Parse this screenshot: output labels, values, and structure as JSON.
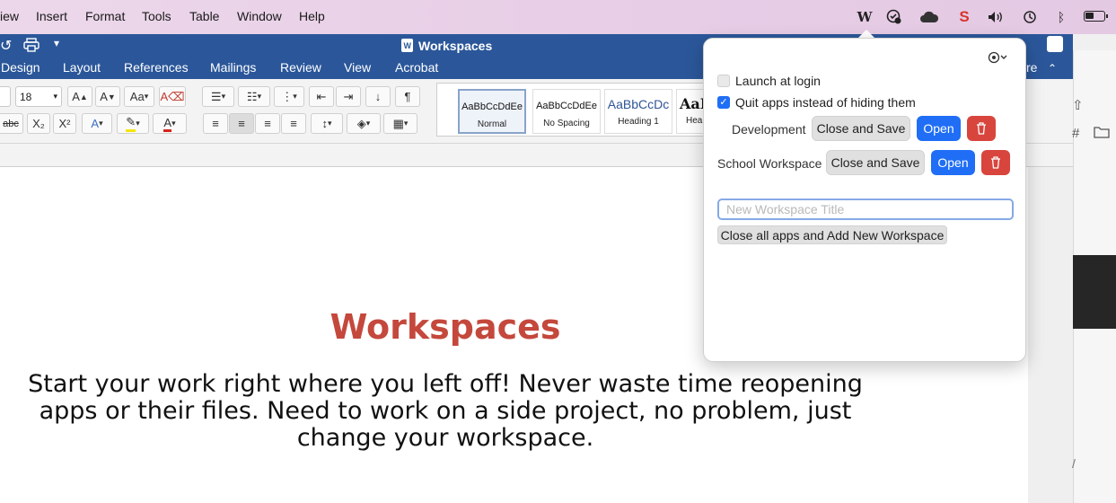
{
  "menubar": {
    "items": [
      "iew",
      "Insert",
      "Format",
      "Tools",
      "Table",
      "Window",
      "Help"
    ],
    "status_icons": [
      "workspaces-app-icon",
      "checkmark-shield-icon",
      "cloud-icon",
      "s-app-icon",
      "volume-icon",
      "time-machine-icon",
      "bluetooth-icon",
      "battery-icon"
    ]
  },
  "word": {
    "window_title": "Workspaces",
    "ribbon_tabs": [
      "Design",
      "Layout",
      "References",
      "Mailings",
      "Review",
      "View",
      "Acrobat"
    ],
    "share_fragment": "re",
    "font_size": "18",
    "styles": [
      {
        "sample": "AaBbCcDdEe",
        "name": "Normal"
      },
      {
        "sample": "AaBbCcDdEe",
        "name": "No Spacing"
      },
      {
        "sample": "AaBbCcDc",
        "name": "Heading 1"
      },
      {
        "sample": "AaB",
        "name": "Hea"
      }
    ],
    "document": {
      "title": "Workspaces",
      "body": "Start your work right where you left off! Never waste time reopening apps or their files. Need to work on a side project, no problem, just change your workspace."
    }
  },
  "popover": {
    "launch_at_login": {
      "label": "Launch at login",
      "checked": false
    },
    "quit_apps": {
      "label": "Quit apps instead of hiding them",
      "checked": true
    },
    "workspaces": [
      {
        "name": "Development",
        "close_label": "Close and Save",
        "open_label": "Open"
      },
      {
        "name": "School Workspace",
        "close_label": "Close and Save",
        "open_label": "Open"
      }
    ],
    "new_title_placeholder": "New Workspace Title",
    "add_button": "Close all apps and Add New Workspace"
  },
  "colors": {
    "word_blue": "#2b579a",
    "accent_blue": "#1f6ef5",
    "delete_red": "#d8453d",
    "doc_title": "#c4483c"
  }
}
